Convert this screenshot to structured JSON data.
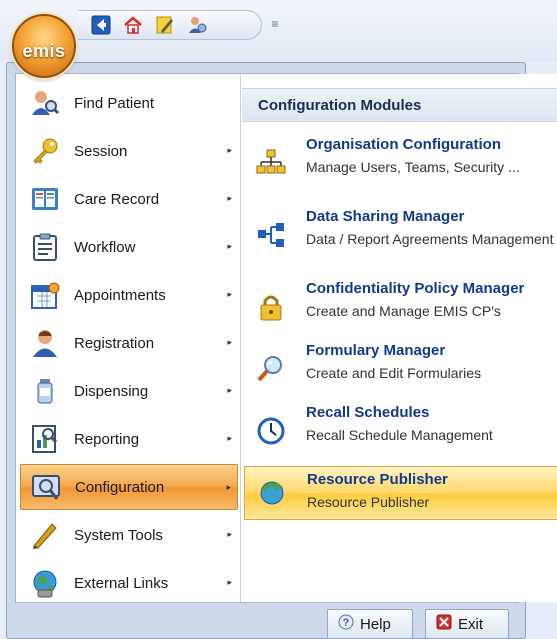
{
  "orb": {
    "label": "emis",
    "icon": "emis-orb-logo"
  },
  "quick_access": [
    {
      "icon": "back-arrow-icon"
    },
    {
      "icon": "home-icon"
    },
    {
      "icon": "edit-pencil-icon"
    },
    {
      "icon": "users-icon"
    }
  ],
  "qat_more": "≡",
  "left_menu": [
    {
      "label": "Find Patient",
      "icon": "find-patient-icon",
      "has_arrow": false
    },
    {
      "label": "Session",
      "icon": "key-icon",
      "has_arrow": true
    },
    {
      "label": "Care Record",
      "icon": "care-record-icon",
      "has_arrow": true
    },
    {
      "label": "Workflow",
      "icon": "clipboard-icon",
      "has_arrow": true
    },
    {
      "label": "Appointments",
      "icon": "calendar-icon",
      "has_arrow": true
    },
    {
      "label": "Registration",
      "icon": "person-icon",
      "has_arrow": true
    },
    {
      "label": "Dispensing",
      "icon": "medicine-bottle-icon",
      "has_arrow": true
    },
    {
      "label": "Reporting",
      "icon": "report-icon",
      "has_arrow": true
    },
    {
      "label": "Configuration",
      "icon": "configuration-icon",
      "has_arrow": true,
      "active": true
    },
    {
      "label": "System Tools",
      "icon": "pencil-icon",
      "has_arrow": true
    },
    {
      "label": "External Links",
      "icon": "globe-icon",
      "has_arrow": true
    }
  ],
  "right_panel": {
    "header": "Configuration Modules",
    "modules": [
      {
        "title": "Organisation Configuration",
        "description": "Manage Users, Teams, Security ...",
        "icon": "org-chart-icon"
      },
      {
        "title": "Data Sharing Manager",
        "description": "Data / Report Agreements Management",
        "icon": "data-sharing-icon"
      },
      {
        "title": "Confidentiality Policy Manager",
        "description": "Create and Manage EMIS CP's",
        "icon": "padlock-icon"
      },
      {
        "title": "Formulary Manager",
        "description": "Create and Edit Formularies",
        "icon": "magnifier-icon"
      },
      {
        "title": "Recall Schedules",
        "description": "Recall Schedule Management",
        "icon": "clock-icon"
      },
      {
        "title": "Resource Publisher",
        "description": "Resource Publisher",
        "icon": "publish-icon",
        "active": true
      }
    ]
  },
  "bottom_bar": {
    "help_label": "Help",
    "exit_label": "Exit"
  },
  "colors": {
    "active_menu": "#f5a64a",
    "active_module": "#ffd86a",
    "module_title": "#123a8c"
  }
}
